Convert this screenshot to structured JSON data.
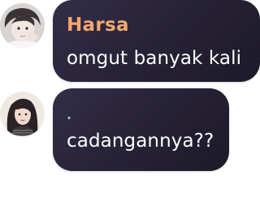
{
  "messages": [
    {
      "sender": "Harsa",
      "text": "omgut banyak kali",
      "avatar_icon": "avatar-boy-icon"
    },
    {
      "sender": ".",
      "text": "cadangannya??",
      "avatar_icon": "avatar-girl-icon"
    }
  ],
  "colors": {
    "bubble_bg": "#2a2538",
    "sender_name": "#f2a86e",
    "message_text": "#ffffff"
  }
}
